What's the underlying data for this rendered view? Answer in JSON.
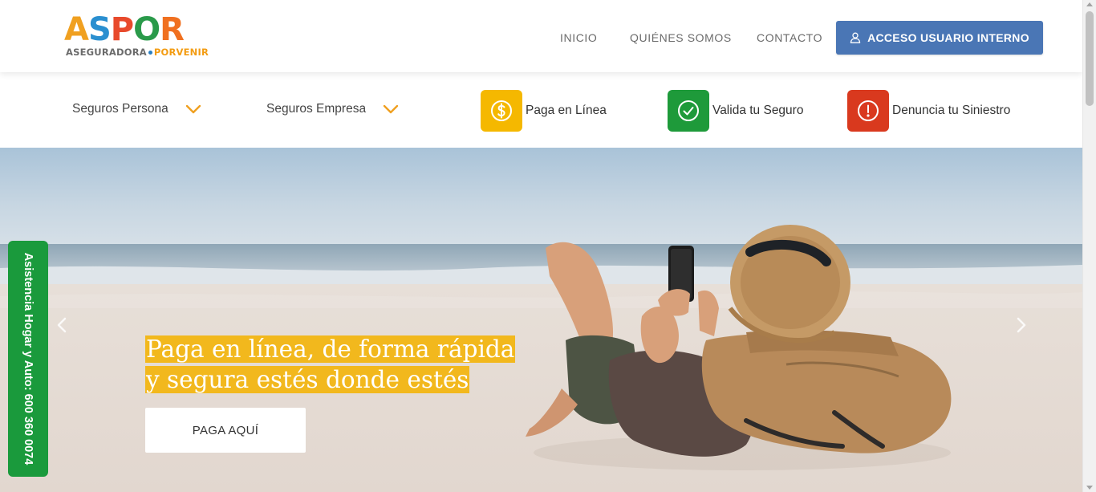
{
  "logo": {
    "letters": [
      "A",
      "S",
      "P",
      "O",
      "R"
    ],
    "letter_colors": [
      "#f0a020",
      "#2a8fd0",
      "#e84a2c",
      "#2a9a4a",
      "#f07020"
    ],
    "sub_left": "ASEGURADORA",
    "sub_right": "PORVENIR"
  },
  "nav": {
    "items": [
      {
        "label": "INICIO"
      },
      {
        "label": "QUIÉNES SOMOS"
      },
      {
        "label": "CONTACTO"
      }
    ],
    "access_button": "ACCESO USUARIO INTERNO",
    "access_icon": "user-icon",
    "access_color": "#4a76b5"
  },
  "subnav": {
    "dropdowns": [
      {
        "label": "Seguros Persona",
        "icon": "chevron-down-icon"
      },
      {
        "label": "Seguros Empresa",
        "icon": "chevron-down-icon"
      }
    ],
    "quick_links": [
      {
        "label": "Paga en Línea",
        "icon": "dollar-icon",
        "color": "#f5b800"
      },
      {
        "label": "Valida tu Seguro",
        "icon": "check-icon",
        "color": "#1e9a3a"
      },
      {
        "label": "Denuncia tu Siniestro",
        "icon": "alert-icon",
        "color": "#d9391e"
      }
    ],
    "chevron_color": "#f0a020"
  },
  "hero": {
    "title_line1": "Paga en línea, de forma rápida",
    "title_line2": "y segura estés donde estés",
    "highlight_color": "#f2b81d",
    "button": "PAGA AQUÍ",
    "prev_icon": "chevron-left-icon",
    "next_icon": "chevron-right-icon"
  },
  "side_tab": {
    "label": "Asistencia Hogar y Auto: 600 360 0074",
    "color": "#1a9a3c"
  }
}
